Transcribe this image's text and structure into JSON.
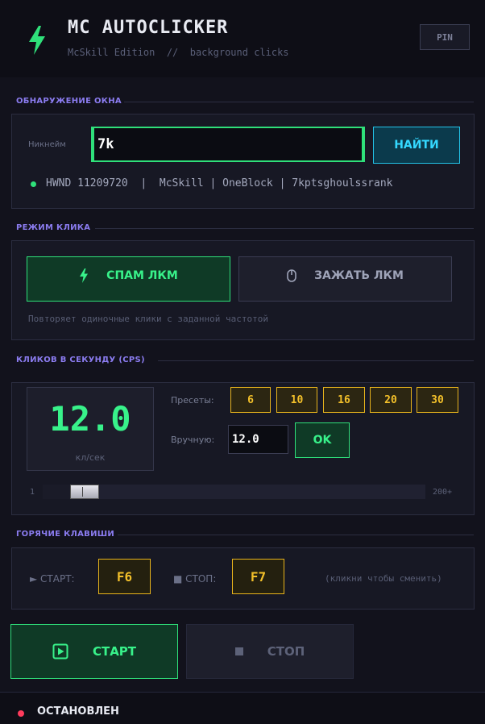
{
  "header": {
    "title": "MC AUTOCLICKER",
    "subtitle": "McSkill Edition  //  background clicks",
    "pin_label": "PIN"
  },
  "window_detect": {
    "section_label": "ОБНАРУЖЕНИЕ ОКНА",
    "nick_label": "Никнейм",
    "nick_value": "7k",
    "find_label": "НАЙТИ",
    "hwnd_info": "HWND 11209720  |  McSkill | OneBlock | 7kptsghoulssrank"
  },
  "click_mode": {
    "section_label": "РЕЖИМ КЛИКА",
    "spam_label": "СПАМ ЛКМ",
    "hold_label": "ЗАЖАТЬ ЛКМ",
    "description": "Повторяет одиночные клики с заданной частотой"
  },
  "cps": {
    "section_label": "КЛИКОВ В СЕКУНДУ (CPS)",
    "value": "12.0",
    "unit": "кл/сек",
    "presets_label": "Пресеты:",
    "presets": [
      "6",
      "10",
      "16",
      "20",
      "30"
    ],
    "manual_label": "Вручную:",
    "manual_value": "12.0",
    "ok_label": "OK",
    "slider_min": "1",
    "slider_max": "200+",
    "slider_fraction": 0.06
  },
  "hotkeys": {
    "section_label": "ГОРЯЧИЕ КЛАВИШИ",
    "start_label": "► СТАРТ:",
    "start_key": "F6",
    "stop_label": "■ СТОП:",
    "stop_key": "F7",
    "hint": "(кликни чтобы сменить)"
  },
  "controls": {
    "start_label": "СТАРТ",
    "stop_label": "СТОП"
  },
  "status": {
    "text": "ОСТАНОВЛЕН",
    "color": "#ff3b5c"
  },
  "colors": {
    "accent_green": "#2fe07a",
    "accent_cyan": "#23c3e8",
    "accent_yellow": "#e8b41c",
    "accent_purple": "#8b7cf0"
  }
}
